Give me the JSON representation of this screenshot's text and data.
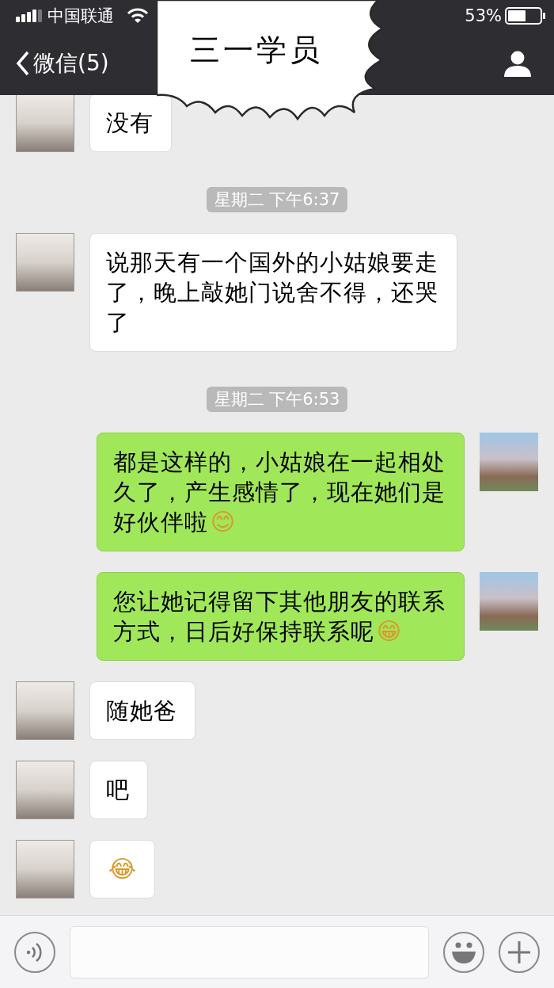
{
  "status_bar": {
    "carrier": "中国联通",
    "battery": "53%"
  },
  "nav": {
    "back_label": "微信(5)"
  },
  "title_bubble": {
    "text": "三一学员"
  },
  "messages": [
    {
      "kind": "received",
      "text": "没有"
    },
    {
      "kind": "time",
      "text": "星期二 下午6:37"
    },
    {
      "kind": "received",
      "text": "说那天有一个国外的小姑娘要走了，晚上敲她门说舍不得，还哭了"
    },
    {
      "kind": "time",
      "text": "星期二 下午6:53"
    },
    {
      "kind": "sent",
      "text": "都是这样的，小姑娘在一起相处久了，产生感情了，现在她们是好伙伴啦",
      "emoji": "😊"
    },
    {
      "kind": "sent",
      "text": "您让她记得留下其他朋友的联系方式，日后好保持联系呢",
      "emoji": "😁"
    },
    {
      "kind": "received",
      "text": "随她爸"
    },
    {
      "kind": "received",
      "text": "吧"
    },
    {
      "kind": "received",
      "emoji": "😂"
    }
  ]
}
